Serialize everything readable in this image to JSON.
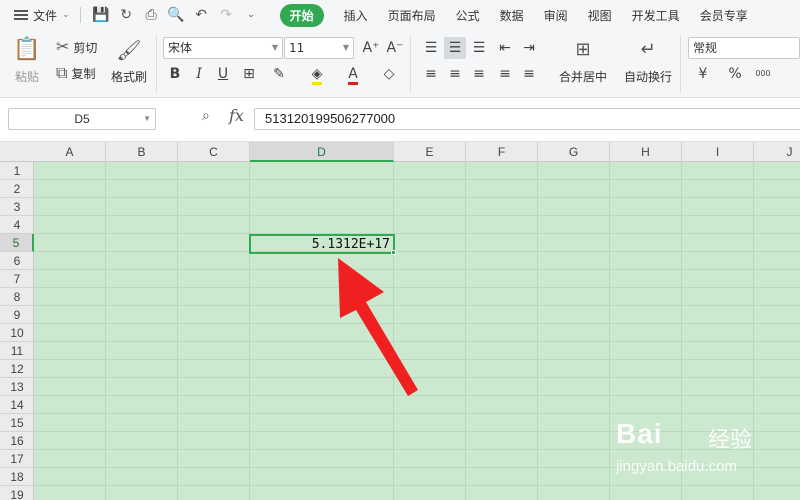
{
  "menubar": {
    "file_label": "文件",
    "tabs": [
      "开始",
      "插入",
      "页面布局",
      "公式",
      "数据",
      "审阅",
      "视图",
      "开发工具",
      "会员专享"
    ]
  },
  "ribbon": {
    "paste_label": "粘贴",
    "cut_label": "剪切",
    "copy_label": "复制",
    "format_painter_label": "格式刷",
    "font_name": "宋体",
    "font_size": "11",
    "merge_center_label": "合并居中",
    "wrap_text_label": "自动换行",
    "number_format": "常规",
    "currency_symbol": "¥",
    "percent_symbol": "%",
    "thousands_symbol": "000"
  },
  "formula_bar": {
    "name_box": "D5",
    "fx_label": "fx",
    "formula": "513120199506277000"
  },
  "sheet": {
    "columns": [
      "A",
      "B",
      "C",
      "D",
      "E",
      "F",
      "G",
      "H",
      "I",
      "J"
    ],
    "rows": [
      "1",
      "2",
      "3",
      "4",
      "5",
      "6",
      "7",
      "8",
      "9",
      "10",
      "11",
      "12",
      "13",
      "14",
      "15",
      "16",
      "17",
      "18",
      "19"
    ],
    "selected_cell_display": "5.1312E+17"
  },
  "watermark": {
    "brand": "Bai",
    "cn": "经验",
    "url": "jingyan.baidu.com"
  },
  "colors": {
    "accent": "#33a852",
    "grid_background": "#cce8cf",
    "arrow": "#f02020"
  }
}
